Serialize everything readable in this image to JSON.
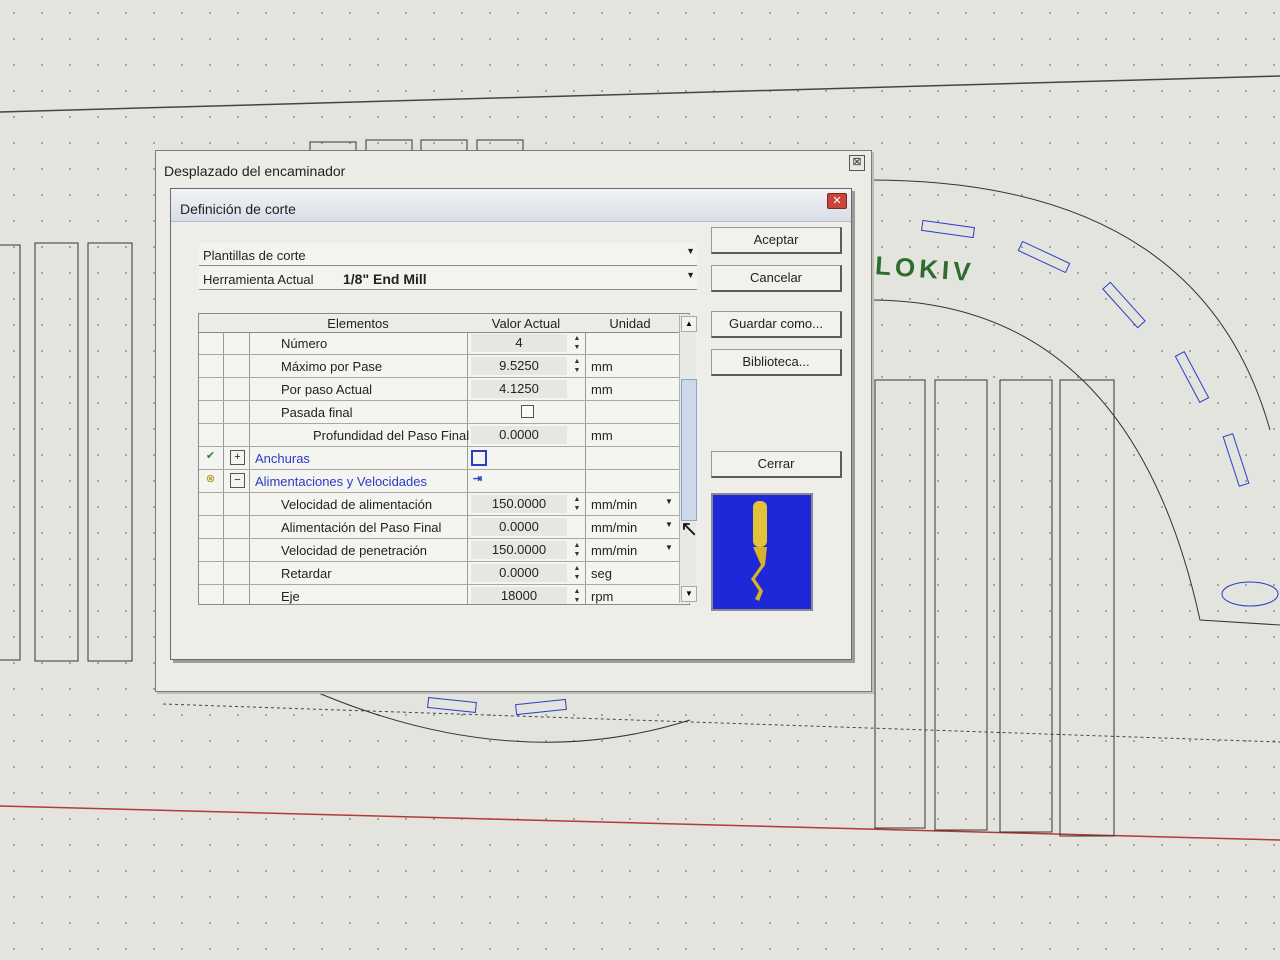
{
  "outer_window": {
    "title": "Desplazado del encaminador",
    "close_label": "⊠"
  },
  "dialog": {
    "title": "Definición de corte",
    "close_label": "✕",
    "cut_templates_label": "Plantillas de corte",
    "current_tool_label": "Herramienta Actual",
    "current_tool_value": "1/8\" End Mill"
  },
  "buttons": {
    "accept": "Aceptar",
    "cancel": "Cancelar",
    "save_as": "Guardar como...",
    "library": "Biblioteca...",
    "close": "Cerrar"
  },
  "grid": {
    "headers": [
      "Elementos",
      "Valor Actual",
      "Unidad"
    ],
    "rows": [
      {
        "label": "Número",
        "value": "4",
        "unit": ""
      },
      {
        "label": "Máximo por Pase",
        "value": "9.5250",
        "unit": "mm"
      },
      {
        "label": "Por paso Actual",
        "value": "4.1250",
        "unit": "mm"
      },
      {
        "label": "Pasada final",
        "value": "",
        "unit": ""
      },
      {
        "label": "Profundidad del Paso Final",
        "value": "0.0000",
        "unit": "mm"
      },
      {
        "label": "Anchuras",
        "value": "",
        "unit": ""
      },
      {
        "label": "Alimentaciones y Velocidades",
        "value": "",
        "unit": ""
      },
      {
        "label": "Velocidad de alimentación",
        "value": "150.0000",
        "unit": "mm/min"
      },
      {
        "label": "Alimentación del Paso Final",
        "value": "0.0000",
        "unit": "mm/min"
      },
      {
        "label": "Velocidad de penetración",
        "value": "150.0000",
        "unit": "mm/min"
      },
      {
        "label": "Retardar",
        "value": "0.0000",
        "unit": "seg"
      },
      {
        "label": "Eje",
        "value": "18000",
        "unit": "rpm"
      }
    ]
  },
  "canvas": {
    "logo_text": "LOKIV"
  }
}
